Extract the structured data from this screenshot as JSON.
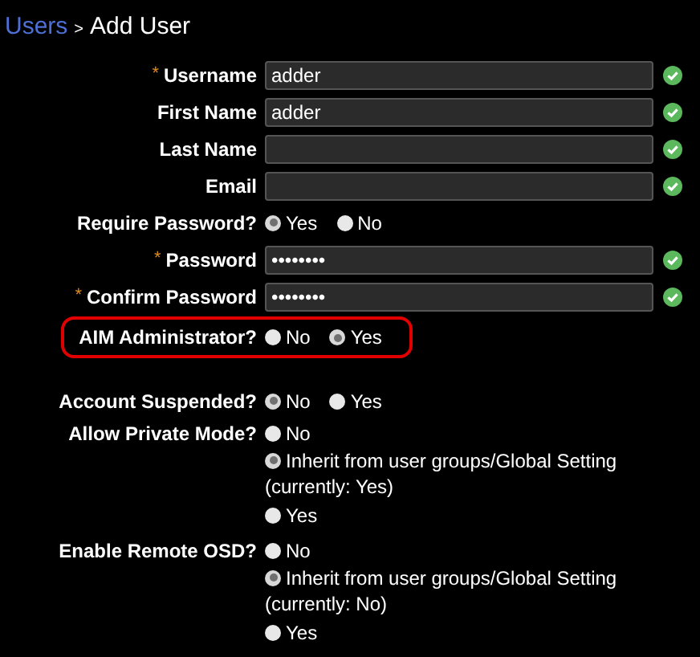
{
  "breadcrumb": {
    "parent": "Users",
    "separator": ">",
    "current": "Add User"
  },
  "fields": [
    {
      "kind": "text",
      "label": "Username",
      "marker": "*",
      "value": "adder",
      "valid": true
    },
    {
      "kind": "text",
      "label": "First Name",
      "value": "adder",
      "valid": true
    },
    {
      "kind": "text",
      "label": "Last Name",
      "valid": true
    },
    {
      "kind": "text",
      "label": "Email",
      "valid": true
    },
    {
      "kind": "radio",
      "label": "Require Password?",
      "options": [
        {
          "label": "Yes",
          "selected": true
        },
        {
          "label": "No",
          "selected": false
        }
      ]
    },
    {
      "kind": "password",
      "label": "Password",
      "marker": "*",
      "value": "••••••••",
      "valid": true
    },
    {
      "kind": "password",
      "label": "Confirm Password",
      "marker": "*",
      "value": "••••••••",
      "valid": true
    },
    {
      "kind": "radio",
      "label": "AIM Administrator?",
      "highlighted": true,
      "options": [
        {
          "label": "No",
          "selected": false
        },
        {
          "label": "Yes",
          "selected": true
        }
      ]
    },
    {
      "kind": "radio",
      "label": "Account Suspended?",
      "spaced": true,
      "options": [
        {
          "label": "No",
          "selected": true
        },
        {
          "label": "Yes",
          "selected": false
        }
      ]
    },
    {
      "kind": "stacked",
      "label": "Allow Private Mode?",
      "options": [
        {
          "label": "No",
          "selected": false
        },
        {
          "label": "Inherit from user groups/Global Setting",
          "note": "(currently: Yes)",
          "selected": true
        },
        {
          "label": "Yes",
          "selected": false
        }
      ]
    },
    {
      "kind": "stacked",
      "label": "Enable Remote OSD?",
      "options": [
        {
          "label": "No",
          "selected": false
        },
        {
          "label": "Inherit from user groups/Global Setting",
          "note": "(currently: No)",
          "selected": true
        },
        {
          "label": "Yes",
          "selected": false
        }
      ]
    }
  ]
}
